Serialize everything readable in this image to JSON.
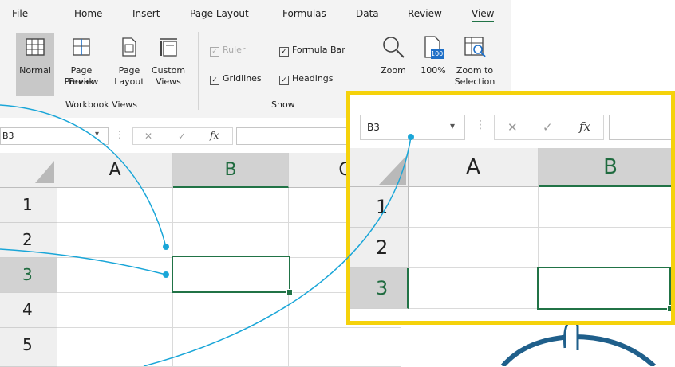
{
  "tabs": [
    "File",
    "Home",
    "Insert",
    "Page Layout",
    "Formulas",
    "Data",
    "Review",
    "View"
  ],
  "active_tab": "View",
  "workbook_views": {
    "buttons": [
      {
        "line1": "Normal",
        "line2": ""
      },
      {
        "line1": "Page Break",
        "line2": "Preview"
      },
      {
        "line1": "Page",
        "line2": "Layout"
      },
      {
        "line1": "Custom",
        "line2": "Views"
      }
    ],
    "group_label": "Workbook Views"
  },
  "show": {
    "ruler": "Ruler",
    "formula_bar": "Formula Bar",
    "gridlines": "Gridlines",
    "headings": "Headings",
    "group_label": "Show"
  },
  "zoom_group": {
    "zoom": "Zoom",
    "hundred": "100%",
    "hundred_icon": "100",
    "zoom_sel_1": "Zoom to",
    "zoom_sel_2": "Selection"
  },
  "formula_bar": {
    "name_box": "B3",
    "dropdown": "▾",
    "cancel": "✕",
    "enter": "✓",
    "fx": "fx"
  },
  "grid": {
    "columns": [
      "A",
      "B",
      "C"
    ],
    "rows": [
      "1",
      "2",
      "3",
      "4",
      "5"
    ],
    "selected_cell": "B3"
  },
  "zoomed": {
    "name_box": "B3",
    "columns": [
      "A",
      "B"
    ],
    "rows": [
      "1",
      "2",
      "3"
    ]
  },
  "colors": {
    "accent": "#217346",
    "callout_line": "#1aa6d8",
    "highlight_border": "#f5d20b"
  }
}
